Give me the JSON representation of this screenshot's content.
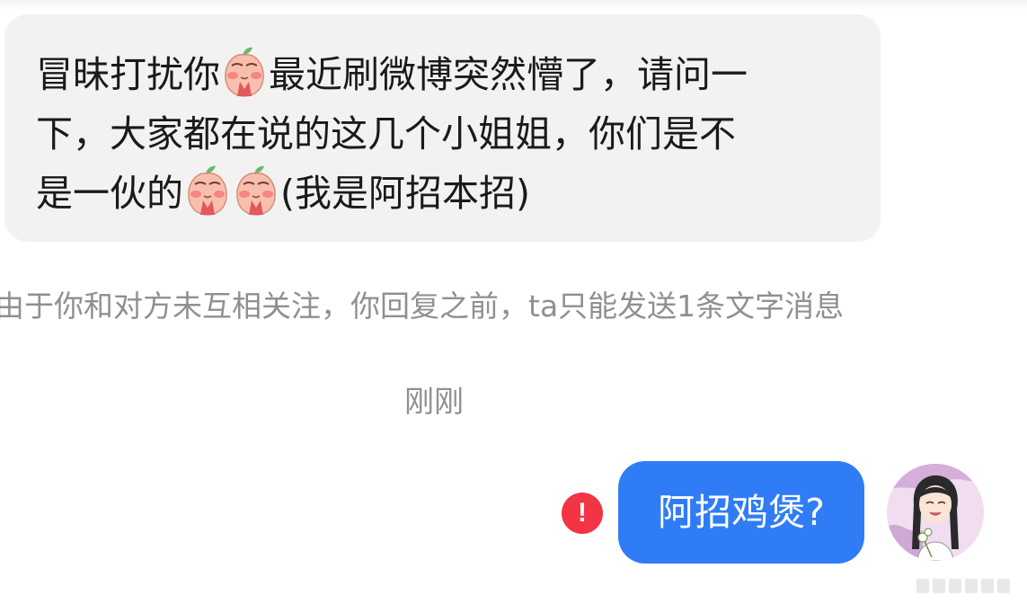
{
  "incoming_message": {
    "line1_a": "冒昧打扰你",
    "line1_b": "最近刷微博突然懵了，请问一",
    "line2": "下，大家都在说的这几个小姐姐，你们是不",
    "line3_a": "是一伙的",
    "line3_b": "(我是阿招本招)",
    "emoji_name": "peach-blush-emoji"
  },
  "notice_text": "由于你和对方未互相关注，你回复之前，ta只能发送1条文字消息",
  "timestamp": "刚刚",
  "outgoing_message": {
    "text": "阿招鸡煲?",
    "status": "failed",
    "status_icon": "!",
    "bubble_color": "#2f7cf6",
    "error_color": "#f23445"
  },
  "avatar": {
    "name": "user-avatar"
  }
}
